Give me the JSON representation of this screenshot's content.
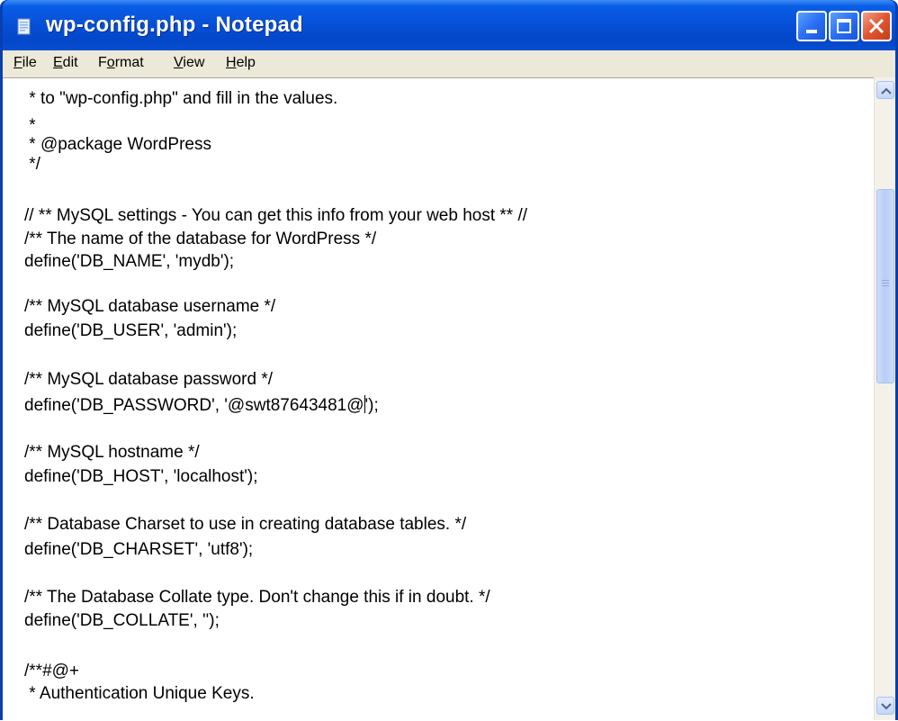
{
  "window": {
    "title": "wp-config.php - Notepad"
  },
  "menu": {
    "file": {
      "mnemonic": "F",
      "rest": "ile"
    },
    "edit": {
      "mnemonic": "E",
      "rest": "dit"
    },
    "format": {
      "pre": "F",
      "mnemonic": "o",
      "rest": "rmat"
    },
    "view": {
      "mnemonic": "V",
      "rest": "iew"
    },
    "help": {
      "mnemonic": "H",
      "rest": "elp"
    }
  },
  "editor": {
    "lines": [
      " * to \"wp-config.php\" and fill in the values.",
      " *",
      " * @package WordPress",
      " */",
      "",
      "// ** MySQL settings - You can get this info from your web host ** //",
      "/** The name of the database for WordPress */",
      "define('DB_NAME', 'mydb');",
      "",
      "/** MySQL database username */",
      "define('DB_USER', 'admin');",
      "",
      "/** MySQL database password */",
      "",
      "",
      "/** MySQL hostname */",
      "define('DB_HOST', 'localhost');",
      "",
      "/** Database Charset to use in creating database tables. */",
      "define('DB_CHARSET', 'utf8');",
      "",
      "/** The Database Collate type. Don't change this if in doubt. */",
      "define('DB_COLLATE', '');",
      "",
      "/**#@+",
      " * Authentication Unique Keys."
    ],
    "password_line_before_caret": "define('DB_PASSWORD', '@swt87643481@",
    "password_line_after_caret": "');"
  },
  "colors": {
    "titlebar": "#0651d8",
    "menubar": "#ece9d8",
    "close_button": "#e05530"
  },
  "icons": {
    "app": "notepad-icon",
    "minimize": "minimize-icon",
    "maximize": "maximize-icon",
    "close": "close-icon",
    "scroll_up": "chevron-up-icon",
    "scroll_down": "chevron-down-icon"
  }
}
